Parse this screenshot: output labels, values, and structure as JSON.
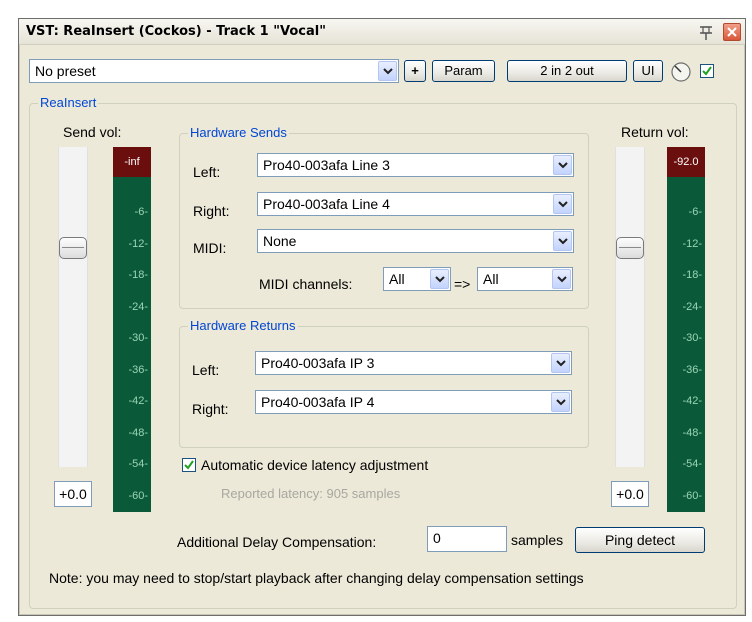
{
  "window": {
    "title": "VST: ReaInsert (Cockos) - Track 1 \"Vocal\""
  },
  "toolbar": {
    "preset_value": "No preset",
    "add_label": "+",
    "param_label": "Param",
    "io_label": "2 in 2 out",
    "ui_label": "UI",
    "enabled": true
  },
  "plugin_group": {
    "label": "ReaInsert"
  },
  "send": {
    "label": "Send vol:",
    "value": "+0.0",
    "peak": "-inf",
    "ticks": [
      "-6-",
      "-12-",
      "-18-",
      "-24-",
      "-30-",
      "-36-",
      "-42-",
      "-48-",
      "-54-",
      "-60-"
    ]
  },
  "return": {
    "label": "Return vol:",
    "value": "+0.0",
    "peak": "-92.0",
    "ticks": [
      "-6-",
      "-12-",
      "-18-",
      "-24-",
      "-30-",
      "-36-",
      "-42-",
      "-48-",
      "-54-",
      "-60-"
    ]
  },
  "hardware_sends": {
    "label": "Hardware Sends",
    "left_label": "Left:",
    "left_value": "Pro40-003afa Line 3",
    "right_label": "Right:",
    "right_value": "Pro40-003afa Line 4",
    "midi_label": "MIDI:",
    "midi_value": "None",
    "midi_channels_label": "MIDI channels:",
    "midi_channel_in": "All",
    "arrow_label": "=>",
    "midi_channel_out": "All"
  },
  "hardware_returns": {
    "label": "Hardware Returns",
    "left_label": "Left:",
    "left_value": "Pro40-003afa IP 3",
    "right_label": "Right:",
    "right_value": "Pro40-003afa IP 4"
  },
  "latency": {
    "checkbox_label": "Automatic device latency adjustment",
    "checked": true,
    "reported": "Reported latency: 905 samples"
  },
  "delay": {
    "label": "Additional Delay Compensation:",
    "value": "0",
    "unit": "samples",
    "ping_label": "Ping detect"
  },
  "note": "Note: you may need to stop/start playback after changing delay compensation settings",
  "colors": {
    "group_label": "#0046d5",
    "meter_bg": "#0a5a3a",
    "meter_peak": "#6a0e0e"
  }
}
